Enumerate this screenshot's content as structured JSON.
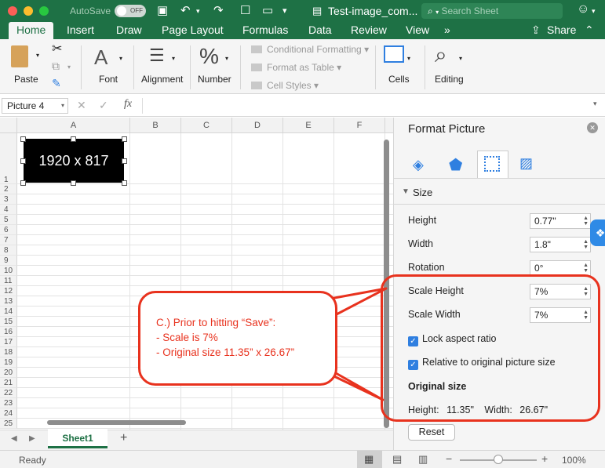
{
  "window": {
    "autosave_label": "AutoSave",
    "autosave_state": "OFF",
    "doc_title": "Test-image_com...",
    "search_placeholder": "Search Sheet",
    "traffic_colors": [
      "#fd5f57",
      "#febc2e",
      "#28c840"
    ]
  },
  "tabs": [
    "Home",
    "Insert",
    "Draw",
    "Page Layout",
    "Formulas",
    "Data",
    "Review",
    "View"
  ],
  "tabs_more": "»",
  "share_label": "Share",
  "ribbon": {
    "paste": "Paste",
    "font": "Font",
    "alignment": "Alignment",
    "number": "Number",
    "number_icon": "%",
    "font_icon": "A",
    "conditional_formatting": "Conditional Formatting",
    "format_as_table": "Format as Table",
    "cell_styles": "Cell Styles",
    "cells": "Cells",
    "editing": "Editing"
  },
  "formula_bar": {
    "name_box": "Picture 4",
    "fx": "fx"
  },
  "grid": {
    "columns": [
      "A",
      "B",
      "C",
      "D",
      "E",
      "F"
    ],
    "rows": [
      "1",
      "2",
      "3",
      "4",
      "5",
      "6",
      "7",
      "8",
      "9",
      "10",
      "11",
      "12",
      "13",
      "14",
      "15",
      "16",
      "17",
      "18",
      "19",
      "20",
      "21",
      "22",
      "23",
      "24",
      "25"
    ]
  },
  "picture_text": "1920 x 817",
  "sheet_tab": "Sheet1",
  "status": {
    "ready": "Ready",
    "zoom": "100%",
    "zoom_level": 0.5
  },
  "pane": {
    "title": "Format Picture",
    "section": "Size",
    "height_label": "Height",
    "height_value": "0.77\"",
    "width_label": "Width",
    "width_value": "1.8\"",
    "rotation_label": "Rotation",
    "rotation_value": "0°",
    "scale_height_label": "Scale Height",
    "scale_height_value": "7%",
    "scale_width_label": "Scale Width",
    "scale_width_value": "7%",
    "lock_aspect": "Lock aspect ratio",
    "relative_original": "Relative to original picture size",
    "original_size_heading": "Original size",
    "orig_height_label": "Height:",
    "orig_height_value": "11.35\"",
    "orig_width_label": "Width:",
    "orig_width_value": "26.67\"",
    "reset": "Reset"
  },
  "annotation": {
    "line1": "C.) Prior to hitting “Save”:",
    "line2": "- Scale is 7%",
    "line3": "- Original size 11.35” x 26.67”",
    "color": "#e8321e"
  }
}
